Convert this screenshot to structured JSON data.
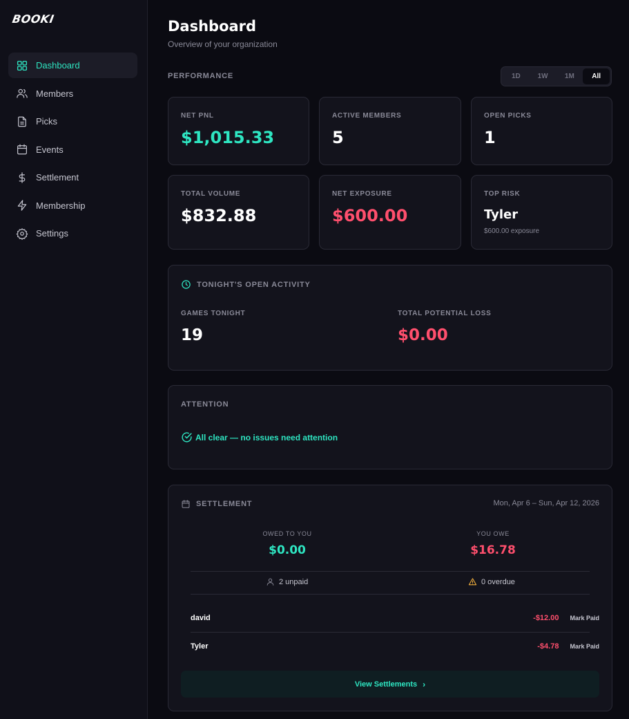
{
  "app": {
    "logo": "BOOKI"
  },
  "sidebar": {
    "items": [
      {
        "label": "Dashboard",
        "icon": "grid-icon",
        "active": true
      },
      {
        "label": "Members",
        "icon": "users-icon"
      },
      {
        "label": "Picks",
        "icon": "file-icon"
      },
      {
        "label": "Events",
        "icon": "calendar-icon"
      },
      {
        "label": "Settlement",
        "icon": "dollar-icon"
      },
      {
        "label": "Membership",
        "icon": "bolt-icon"
      },
      {
        "label": "Settings",
        "icon": "gear-icon"
      }
    ]
  },
  "header": {
    "title": "Dashboard",
    "subtitle": "Overview of your organization"
  },
  "performance": {
    "label": "PERFORMANCE",
    "ranges": [
      "1D",
      "1W",
      "1M",
      "All"
    ],
    "active_range": "All",
    "stats": {
      "net_pnl": {
        "label": "NET PNL",
        "value": "$1,015.33"
      },
      "active_members": {
        "label": "ACTIVE MEMBERS",
        "value": "5"
      },
      "open_picks": {
        "label": "OPEN PICKS",
        "value": "1"
      },
      "total_volume": {
        "label": "TOTAL VOLUME",
        "value": "$832.88"
      },
      "net_exposure": {
        "label": "NET EXPOSURE",
        "value": "$600.00"
      },
      "top_risk": {
        "label": "TOP RISK",
        "value": "Tyler",
        "sub": "$600.00 exposure"
      }
    }
  },
  "activity": {
    "title": "TONIGHT'S OPEN ACTIVITY",
    "games_label": "GAMES TONIGHT",
    "games_value": "19",
    "loss_label": "TOTAL POTENTIAL LOSS",
    "loss_value": "$0.00"
  },
  "attention": {
    "title": "ATTENTION",
    "message": "All clear — no issues need attention"
  },
  "settlement": {
    "title": "SETTLEMENT",
    "date_range": "Mon, Apr 6 – Sun, Apr 12, 2026",
    "owed_label": "OWED TO YOU",
    "owed_value": "$0.00",
    "owe_label": "YOU OWE",
    "owe_value": "$16.78",
    "unpaid": "2 unpaid",
    "overdue": "0 overdue",
    "rows": [
      {
        "name": "david",
        "amount": "-$12.00",
        "action": "Mark Paid"
      },
      {
        "name": "Tyler",
        "amount": "-$4.78",
        "action": "Mark Paid"
      }
    ],
    "view_label": "View Settlements",
    "view_chevron": "›"
  },
  "colors": {
    "accent": "#2ee6c2",
    "negative": "#ff4f6d",
    "warning": "#f5b13d",
    "background": "#0b0b12",
    "card": "#13131c"
  }
}
